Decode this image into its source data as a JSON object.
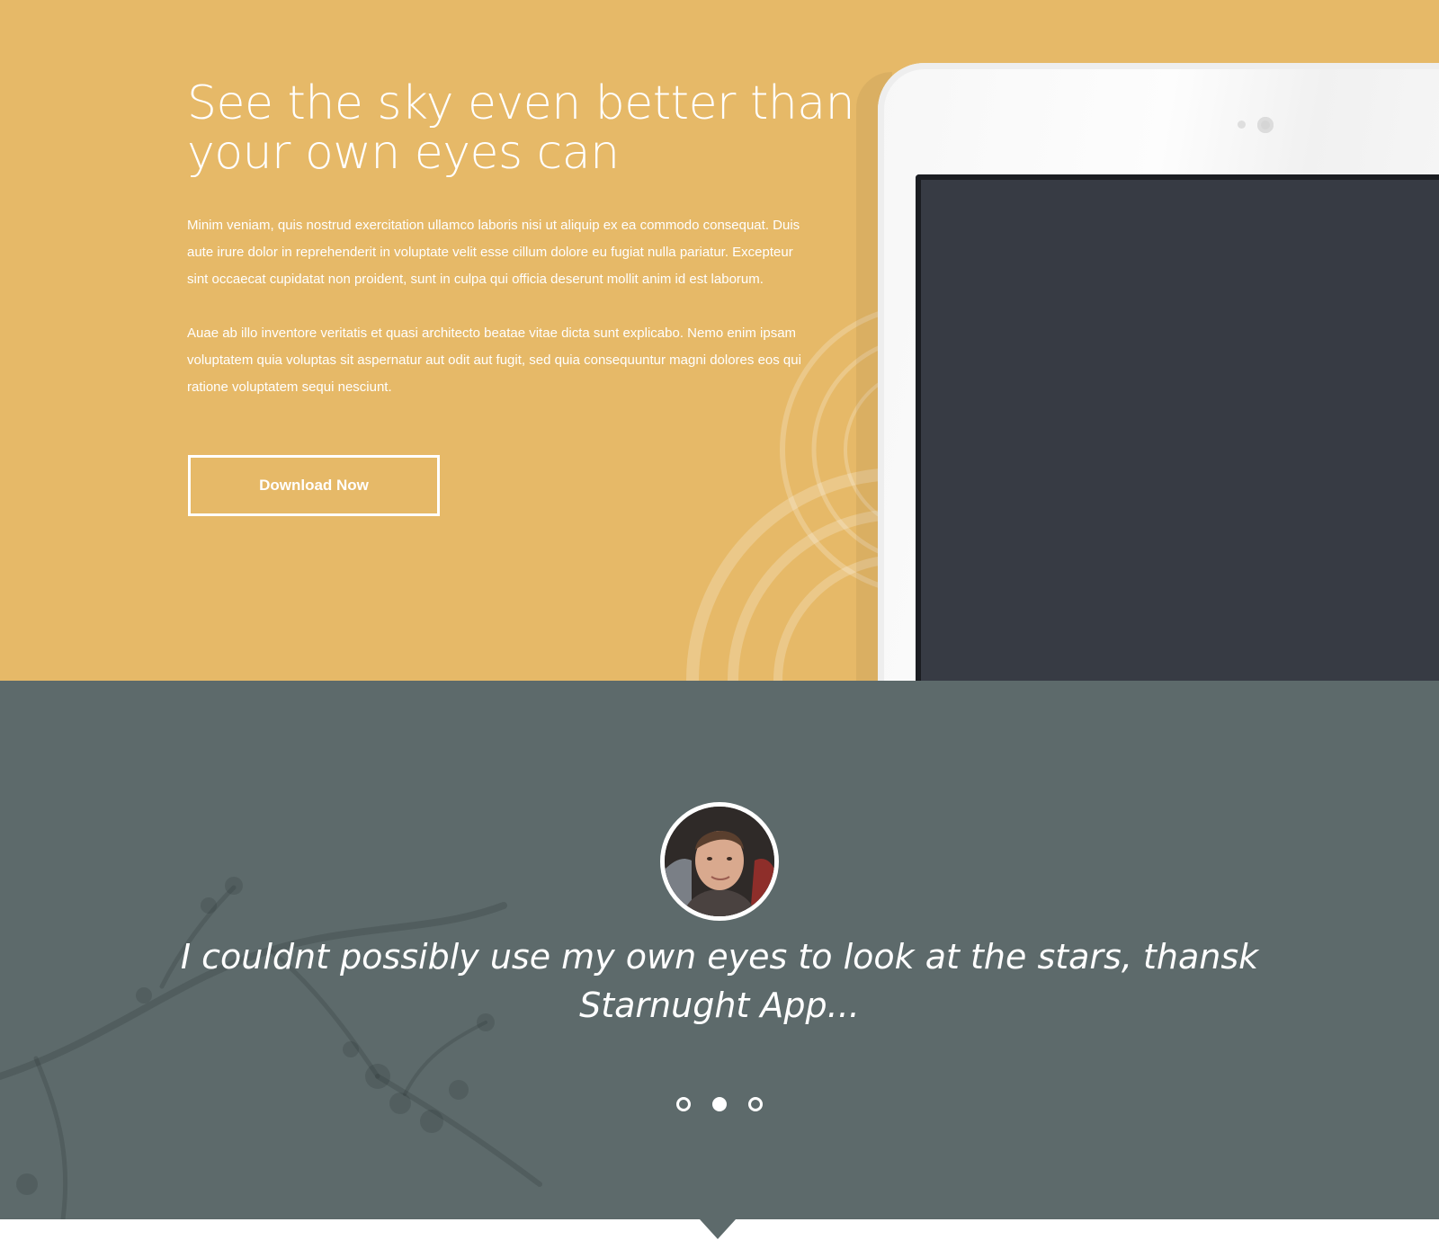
{
  "hero": {
    "title_line1": "See the sky even better than",
    "title_line2": "your own eyes can",
    "paragraph1": "Minim veniam, quis nostrud exercitation ullamco laboris nisi ut aliquip ex ea commodo consequat. Duis aute irure dolor in reprehenderit in voluptate velit esse cillum dolore eu fugiat nulla pariatur. Excepteur sint occaecat cupidatat non proident, sunt in culpa qui officia deserunt mollit anim id est laborum.",
    "paragraph2": "Auae ab illo inventore veritatis et quasi architecto beatae vitae dicta sunt explicabo. Nemo enim ipsam voluptatem quia voluptas sit aspernatur aut odit aut fugit, sed quia consequuntur magni dolores eos qui ratione voluptatem sequi nesciunt.",
    "button_label": "Download Now",
    "background_color": "#e6b968"
  },
  "device": {
    "type": "tablet-icon",
    "screen_color": "#373b44"
  },
  "testimonial": {
    "quote": "I couldnt possibly use my own eyes to look at the stars, thansk Starnught App...",
    "avatar_icon": "person-avatar-icon",
    "background_color": "#5d6a6b",
    "slides": [
      {
        "label": "slide-1",
        "active": false
      },
      {
        "label": "slide-2",
        "active": true
      },
      {
        "label": "slide-3",
        "active": false
      }
    ]
  }
}
